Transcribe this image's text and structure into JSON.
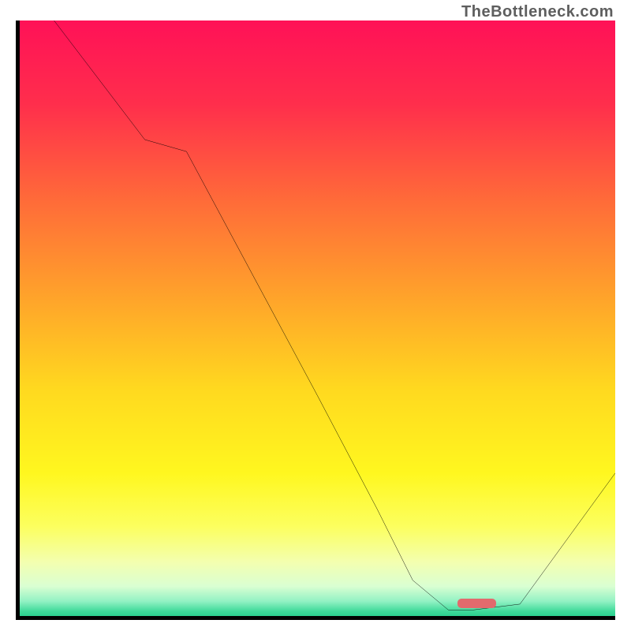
{
  "watermark": "TheBottleneck.com",
  "chart_data": {
    "type": "line",
    "title": "",
    "xlabel": "",
    "ylabel": "",
    "xlim": [
      0,
      100
    ],
    "ylim": [
      0,
      100
    ],
    "grid": false,
    "x": [
      0,
      5,
      21,
      28,
      50,
      60,
      66,
      72,
      76,
      84,
      100
    ],
    "values": [
      103,
      101,
      80,
      78,
      37,
      18,
      6,
      1,
      1,
      2,
      24
    ],
    "gradient_stops": [
      {
        "offset": 0,
        "color": "#ff1157"
      },
      {
        "offset": 14,
        "color": "#ff2e4c"
      },
      {
        "offset": 30,
        "color": "#ff6a39"
      },
      {
        "offset": 47,
        "color": "#ffa52a"
      },
      {
        "offset": 62,
        "color": "#ffd91f"
      },
      {
        "offset": 76,
        "color": "#fff71f"
      },
      {
        "offset": 85,
        "color": "#fcff5f"
      },
      {
        "offset": 91,
        "color": "#f3ffb0"
      },
      {
        "offset": 95,
        "color": "#daffd2"
      },
      {
        "offset": 97.5,
        "color": "#93f2c4"
      },
      {
        "offset": 99.2,
        "color": "#3fd99a"
      },
      {
        "offset": 100,
        "color": "#2bd08f"
      }
    ],
    "marker": {
      "x": 73.5,
      "y": 1.3,
      "w": 6.5,
      "h": 1.6,
      "color": "#e26a6d"
    }
  }
}
